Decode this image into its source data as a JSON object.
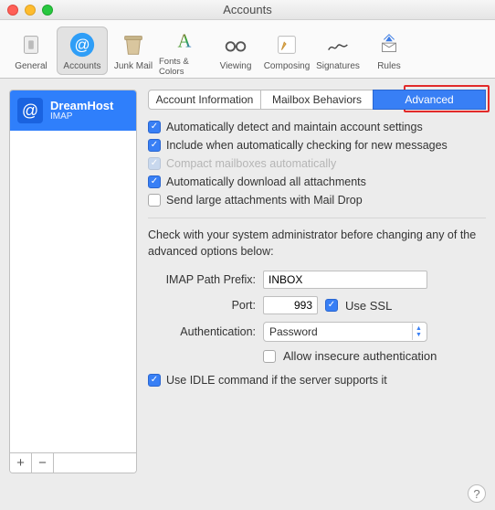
{
  "window": {
    "title": "Accounts"
  },
  "toolbar": {
    "items": [
      {
        "label": "General"
      },
      {
        "label": "Accounts"
      },
      {
        "label": "Junk Mail"
      },
      {
        "label": "Fonts & Colors"
      },
      {
        "label": "Viewing"
      },
      {
        "label": "Composing"
      },
      {
        "label": "Signatures"
      },
      {
        "label": "Rules"
      }
    ],
    "selected_index": 1
  },
  "sidebar": {
    "account": {
      "name": "DreamHost",
      "protocol": "IMAP"
    },
    "add_label": "+",
    "remove_label": "−"
  },
  "tabs": {
    "items": [
      {
        "label": "Account Information"
      },
      {
        "label": "Mailbox Behaviors"
      },
      {
        "label": "Advanced"
      }
    ],
    "active_index": 2
  },
  "checks": {
    "auto_detect": {
      "label": "Automatically detect and maintain account settings",
      "checked": true
    },
    "include_auto_check": {
      "label": "Include when automatically checking for new messages",
      "checked": true
    },
    "compact": {
      "label": "Compact mailboxes automatically",
      "checked": true,
      "disabled": true
    },
    "dl_attach": {
      "label": "Automatically download all attachments",
      "checked": true
    },
    "mail_drop": {
      "label": "Send large attachments with Mail Drop",
      "checked": false
    }
  },
  "note": "Check with your system administrator before changing any of the advanced options below:",
  "form": {
    "imap_prefix": {
      "label": "IMAP Path Prefix:",
      "value": "INBOX"
    },
    "port": {
      "label": "Port:",
      "value": "993"
    },
    "use_ssl": {
      "label": "Use SSL",
      "checked": true
    },
    "auth": {
      "label": "Authentication:",
      "value": "Password"
    },
    "allow_insecure": {
      "label": "Allow insecure authentication",
      "checked": false
    },
    "use_idle": {
      "label": "Use IDLE command if the server supports it",
      "checked": true
    }
  },
  "help_label": "?"
}
